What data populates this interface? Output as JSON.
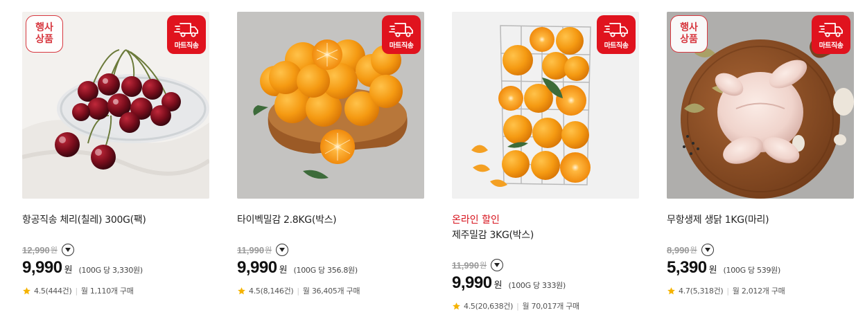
{
  "colors": {
    "accent_red": "#e0131e",
    "promo_red": "#d7131d",
    "star": "#f5b301"
  },
  "products": [
    {
      "event_badge": [
        "행사",
        "상품"
      ],
      "ship_label": "마트직송",
      "promo": "",
      "name": "항공직송 체리(칠레) 300G(팩)",
      "original_price": "12,990",
      "original_won": "원",
      "price": "9,990",
      "won": "원",
      "unit_price": "(100G 당 3,330원)",
      "rating": "4.5(444건)",
      "sales": "월 1,110개 구매",
      "image": "cherries"
    },
    {
      "event_badge": [],
      "ship_label": "마트직송",
      "promo": "",
      "name": "타이벡밀감 2.8KG(박스)",
      "original_price": "11,990",
      "original_won": "원",
      "price": "9,990",
      "won": "원",
      "unit_price": "(100G 당 356.8원)",
      "rating": "4.5(8,146건)",
      "sales": "월 36,405개 구매",
      "image": "tangerines-board"
    },
    {
      "event_badge": [],
      "ship_label": "마트직송",
      "promo": "온라인 할인",
      "name": "제주밀감 3KG(박스)",
      "original_price": "11,990",
      "original_won": "원",
      "price": "9,990",
      "won": "원",
      "unit_price": "(100G 당 333원)",
      "rating": "4.5(20,638건)",
      "sales": "월 70,017개 구매",
      "image": "tangerines-basket"
    },
    {
      "event_badge": [
        "행사",
        "상품"
      ],
      "ship_label": "마트직송",
      "promo": "",
      "name": "무항생제 생닭 1KG(마리)",
      "original_price": "8,990",
      "original_won": "원",
      "price": "5,390",
      "won": "원",
      "unit_price": "(100G 당 539원)",
      "rating": "4.7(5,318건)",
      "sales": "월 2,012개 구매",
      "image": "whole-chicken"
    }
  ]
}
